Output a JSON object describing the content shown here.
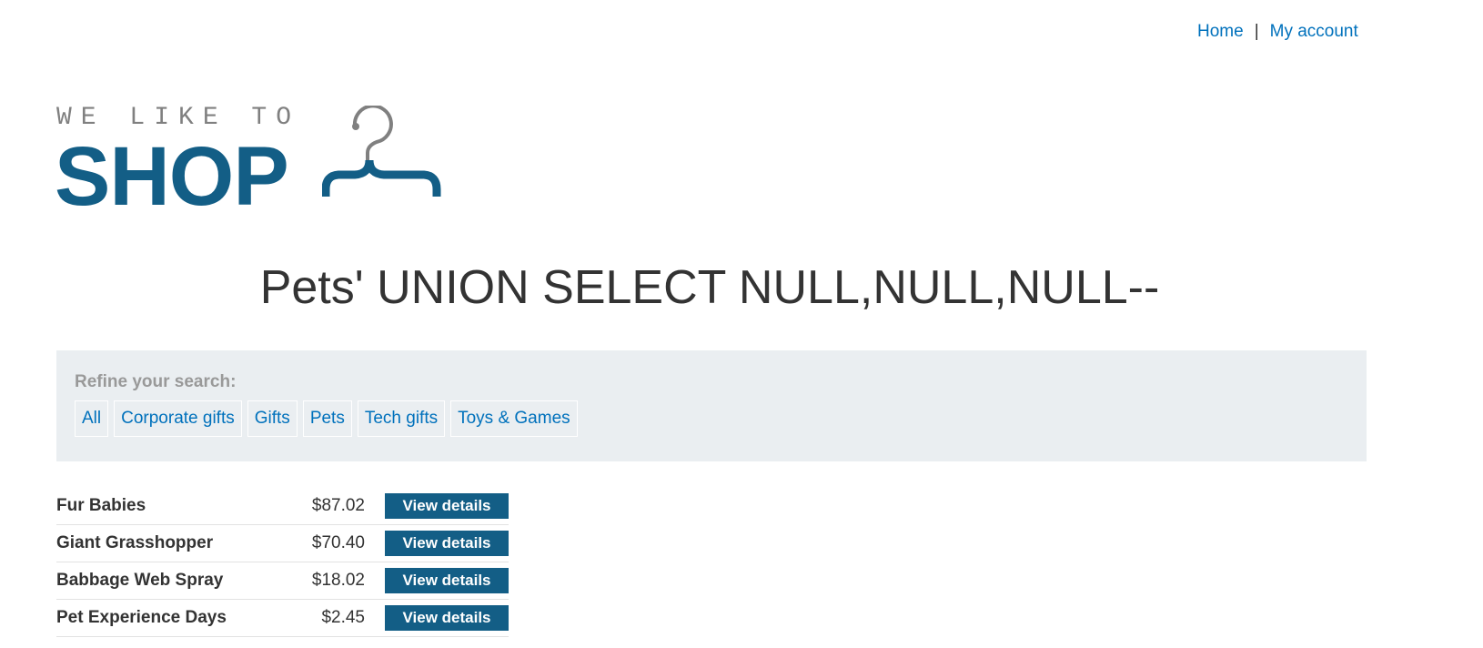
{
  "nav": {
    "home": "Home",
    "separator": "|",
    "account": "My account"
  },
  "logo": {
    "tagline": "WE LIKE TO",
    "brand": "SHOP",
    "icon": "hanger-icon"
  },
  "page": {
    "title": "Pets' UNION SELECT NULL,NULL,NULL--"
  },
  "filters": {
    "heading": "Refine your search:",
    "categories": [
      "All",
      "Corporate gifts",
      "Gifts",
      "Pets",
      "Tech gifts",
      "Toys & Games"
    ]
  },
  "products": [
    {
      "name": "Fur Babies",
      "price": "$87.02",
      "action": "View details"
    },
    {
      "name": "Giant Grasshopper",
      "price": "$70.40",
      "action": "View details"
    },
    {
      "name": "Babbage Web Spray",
      "price": "$18.02",
      "action": "View details"
    },
    {
      "name": "Pet Experience Days",
      "price": "$2.45",
      "action": "View details"
    }
  ],
  "colors": {
    "brand": "#135e86",
    "link": "#0071bc",
    "filter_bg": "#eaeef1",
    "text": "#333333",
    "muted": "#999999"
  }
}
